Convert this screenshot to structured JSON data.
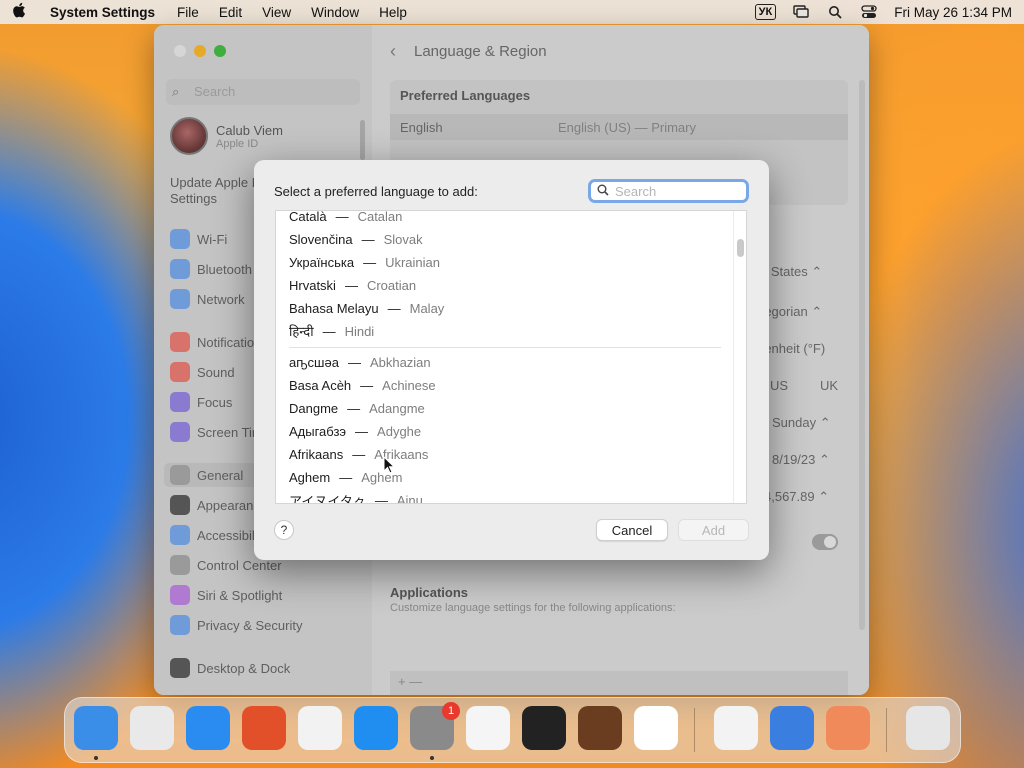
{
  "menubar": {
    "app_name": "System Settings",
    "items": [
      "File",
      "Edit",
      "View",
      "Window",
      "Help"
    ],
    "input_source": "УК",
    "clock": "Fri May 26  1:34 PM"
  },
  "sidebar": {
    "search_placeholder": "Search",
    "account_name": "Calub Viem",
    "account_sub": "Apple ID",
    "update_text": "Update Apple ID Settings",
    "items": [
      {
        "label": "Wi-Fi",
        "icon": "wifi-icon",
        "color": "#6f9cd8"
      },
      {
        "label": "Bluetooth",
        "icon": "bluetooth-icon",
        "color": "#6f9cd8"
      },
      {
        "label": "Network",
        "icon": "globe-icon",
        "color": "#6f9cd8"
      },
      {
        "label": "Notifications",
        "icon": "bell-icon",
        "color": "#d8736c"
      },
      {
        "label": "Sound",
        "icon": "speaker-icon",
        "color": "#d8736c"
      },
      {
        "label": "Focus",
        "icon": "moon-icon",
        "color": "#8a7ad0"
      },
      {
        "label": "Screen Time",
        "icon": "hourglass-icon",
        "color": "#8a7ad0"
      },
      {
        "label": "General",
        "icon": "gear-icon",
        "color": "#9a9a9a"
      },
      {
        "label": "Appearance",
        "icon": "appearance-icon",
        "color": "#555555"
      },
      {
        "label": "Accessibility",
        "icon": "accessibility-icon",
        "color": "#6f9cd8"
      },
      {
        "label": "Control Center",
        "icon": "control-center-icon",
        "color": "#9a9a9a"
      },
      {
        "label": "Siri & Spotlight",
        "icon": "siri-icon",
        "color": "#b07ad0"
      },
      {
        "label": "Privacy & Security",
        "icon": "hand-icon",
        "color": "#6f9cd8"
      },
      {
        "label": "Desktop & Dock",
        "icon": "dock-icon",
        "color": "#555555"
      }
    ]
  },
  "content": {
    "title": "Language & Region",
    "preferred_header": "Preferred Languages",
    "preferred_row_lang": "English",
    "preferred_row_value": "English (US) — Primary",
    "region_value": "d States",
    "calendar_value": "regorian",
    "temperature_value": "renheit (°F)",
    "measure_us": "US",
    "measure_uk": "UK",
    "first_day": "Sunday",
    "date_format": "8/19/23",
    "number_format": "4,567.89",
    "applications_title": "Applications",
    "applications_sub": "Customize language settings for the following applications:",
    "add_remove": "+  —"
  },
  "dialog": {
    "title": "Select a preferred language to add:",
    "search_placeholder": "Search",
    "languages_top": [
      {
        "native": "Català",
        "english": "Catalan"
      },
      {
        "native": "Slovenčina",
        "english": "Slovak"
      },
      {
        "native": "Українська",
        "english": "Ukrainian"
      },
      {
        "native": "Hrvatski",
        "english": "Croatian"
      },
      {
        "native": "Bahasa Melayu",
        "english": "Malay"
      },
      {
        "native": "हिन्दी",
        "english": "Hindi"
      }
    ],
    "languages_rest": [
      {
        "native": "аҧсшәа",
        "english": "Abkhazian"
      },
      {
        "native": "Basa Acèh",
        "english": "Achinese"
      },
      {
        "native": "Dangme",
        "english": "Adangme"
      },
      {
        "native": "Адыгабзэ",
        "english": "Adyghe"
      },
      {
        "native": "Afrikaans",
        "english": "Afrikaans"
      },
      {
        "native": "Aghem",
        "english": "Aghem"
      },
      {
        "native": "アイヌイタㇰ",
        "english": "Ainu"
      }
    ],
    "dash": "—",
    "help_label": "?",
    "cancel_label": "Cancel",
    "add_label": "Add"
  },
  "dock": {
    "apps": [
      {
        "name": "Finder",
        "icon": "finder-icon",
        "color": "#3a8ee8",
        "running": true
      },
      {
        "name": "Launchpad",
        "icon": "launchpad-icon",
        "color": "#e9e9e9",
        "running": false
      },
      {
        "name": "Safari",
        "icon": "safari-icon",
        "color": "#2a8cf0",
        "running": false
      },
      {
        "name": "Firefox",
        "icon": "firefox-icon",
        "color": "#e2502a",
        "running": false
      },
      {
        "name": "Chrome",
        "icon": "chrome-icon",
        "color": "#f2f2f2",
        "running": false
      },
      {
        "name": "App Store",
        "icon": "app-store-icon",
        "color": "#1f8ef0",
        "running": false
      },
      {
        "name": "System Settings",
        "icon": "system-settings-icon",
        "color": "#8a8a8a",
        "running": true,
        "badge": "1"
      },
      {
        "name": "TextEdit",
        "icon": "textedit-icon",
        "color": "#f5f5f5",
        "running": false
      },
      {
        "name": "Terminal",
        "icon": "terminal-icon",
        "color": "#222222",
        "running": false
      },
      {
        "name": "GarageBand",
        "icon": "garageband-icon",
        "color": "#6b3d20",
        "running": false
      },
      {
        "name": "VS Code",
        "icon": "vscode-icon",
        "color": "#ffffff",
        "running": false
      },
      {
        "name": "Visual Studio",
        "icon": "visual-studio-icon",
        "color": "#f3f3f3",
        "running": false
      },
      {
        "name": "Apps",
        "icon": "apps-icon",
        "color": "#3a7fe0",
        "running": false
      },
      {
        "name": "Remote Desktop",
        "icon": "remote-desktop-icon",
        "color": "#f08a5a",
        "running": false
      },
      {
        "name": "Trash",
        "icon": "trash-icon",
        "color": "#e6e6e6",
        "running": false
      }
    ]
  }
}
